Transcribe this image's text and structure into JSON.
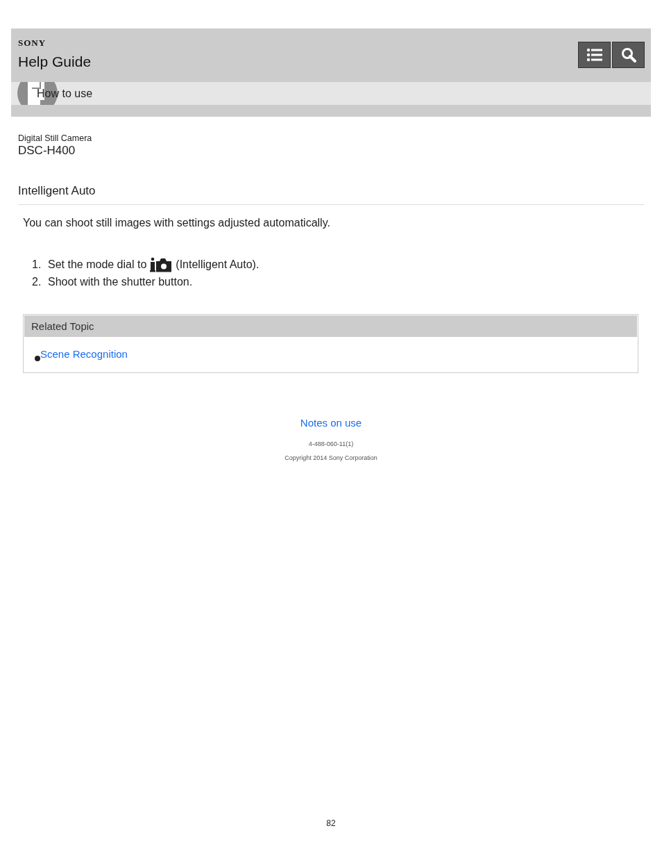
{
  "header": {
    "brand": "SONY",
    "title": "Help Guide"
  },
  "breadcrumb": {
    "label": "How to use"
  },
  "product": {
    "category": "Digital Still Camera",
    "model": "DSC-H400"
  },
  "page_title": "Intelligent Auto",
  "intro": "You can shoot still images with settings adjusted automatically.",
  "steps": [
    {
      "number": "1.",
      "before": "Set the mode dial to",
      "after": "(Intelligent Auto)."
    },
    {
      "number": "2.",
      "before": "Shoot with the shutter button."
    }
  ],
  "related": {
    "heading": "Related Topic",
    "links": [
      "Scene Recognition"
    ]
  },
  "footer": {
    "link": "Notes on use",
    "code": "4-488-060-11(1)",
    "copyright": "Copyright 2014 Sony Corporation",
    "page_number": "82"
  }
}
